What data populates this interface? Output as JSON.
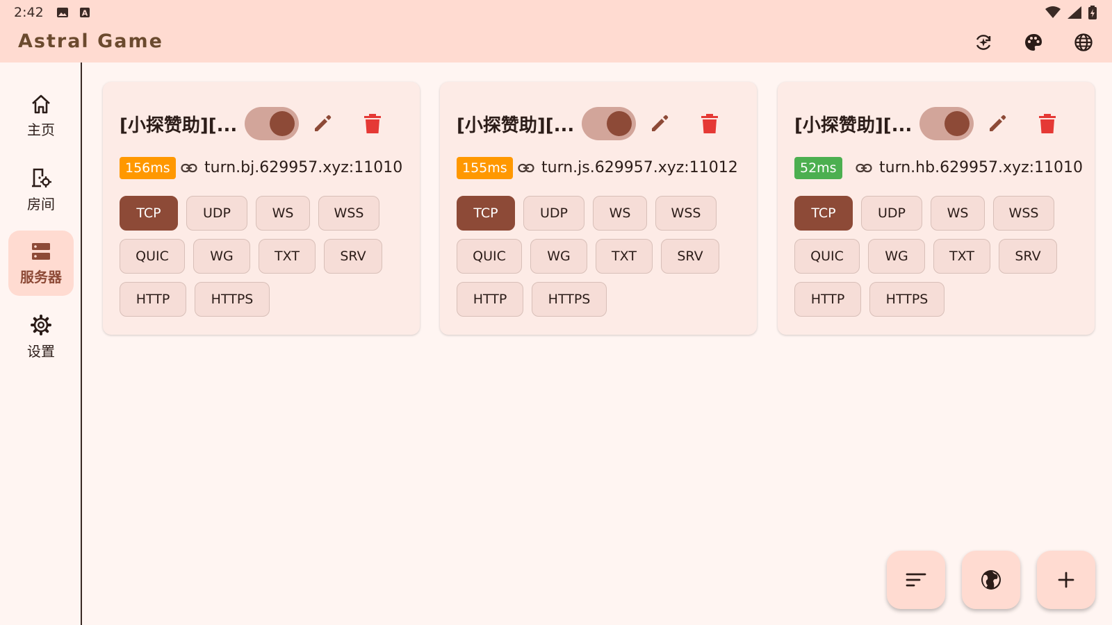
{
  "status_bar": {
    "time": "2:42",
    "icons": [
      "image-icon",
      "a-icon",
      "wifi-icon",
      "signal-icon",
      "battery-icon"
    ]
  },
  "app_bar": {
    "title": "Astral Game",
    "actions": [
      "sparkle-refresh-icon",
      "palette-icon",
      "globe-icon"
    ]
  },
  "nav": {
    "items": [
      {
        "label": "主页",
        "icon": "home-icon",
        "active": false
      },
      {
        "label": "房间",
        "icon": "room-settings-icon",
        "active": false
      },
      {
        "label": "服务器",
        "icon": "server-icon",
        "active": true
      },
      {
        "label": "设置",
        "icon": "gear-icon",
        "active": false
      }
    ]
  },
  "servers": [
    {
      "title": "[小探赞助][...",
      "enabled": true,
      "latency": "156ms",
      "host": "turn.bj.629957.xyz:11010",
      "chip_rows": [
        [
          "TCP",
          "UDP",
          "WS",
          "WSS"
        ],
        [
          "QUIC",
          "WG",
          "TXT",
          "SRV"
        ],
        [
          "HTTP",
          "HTTPS"
        ]
      ]
    },
    {
      "title": "[小探赞助][...",
      "enabled": true,
      "latency": "155ms",
      "host": "turn.js.629957.xyz:11012",
      "chip_rows": [
        [
          "TCP",
          "UDP",
          "WS",
          "WSS"
        ],
        [
          "QUIC",
          "WG",
          "TXT",
          "SRV"
        ],
        [
          "HTTP",
          "HTTPS"
        ]
      ]
    },
    {
      "title": "[小探赞助][...",
      "enabled": true,
      "latency": "52ms",
      "host": "turn.hb.629957.xyz:11010",
      "chip_rows": [
        [
          "TCP",
          "UDP",
          "WS",
          "WSS"
        ],
        [
          "QUIC",
          "WG",
          "TXT",
          "SRV"
        ],
        [
          "HTTP",
          "HTTPS"
        ]
      ]
    }
  ],
  "selected_protocol": "TCP",
  "fabs": [
    "sort-icon",
    "public-globe-icon",
    "add-icon"
  ],
  "colors": {
    "primary": "#8d4a37",
    "appbar": "#ffdbd1",
    "latency_slow": "#ff9800",
    "latency_fast": "#4caf50",
    "delete": "#e53935"
  }
}
